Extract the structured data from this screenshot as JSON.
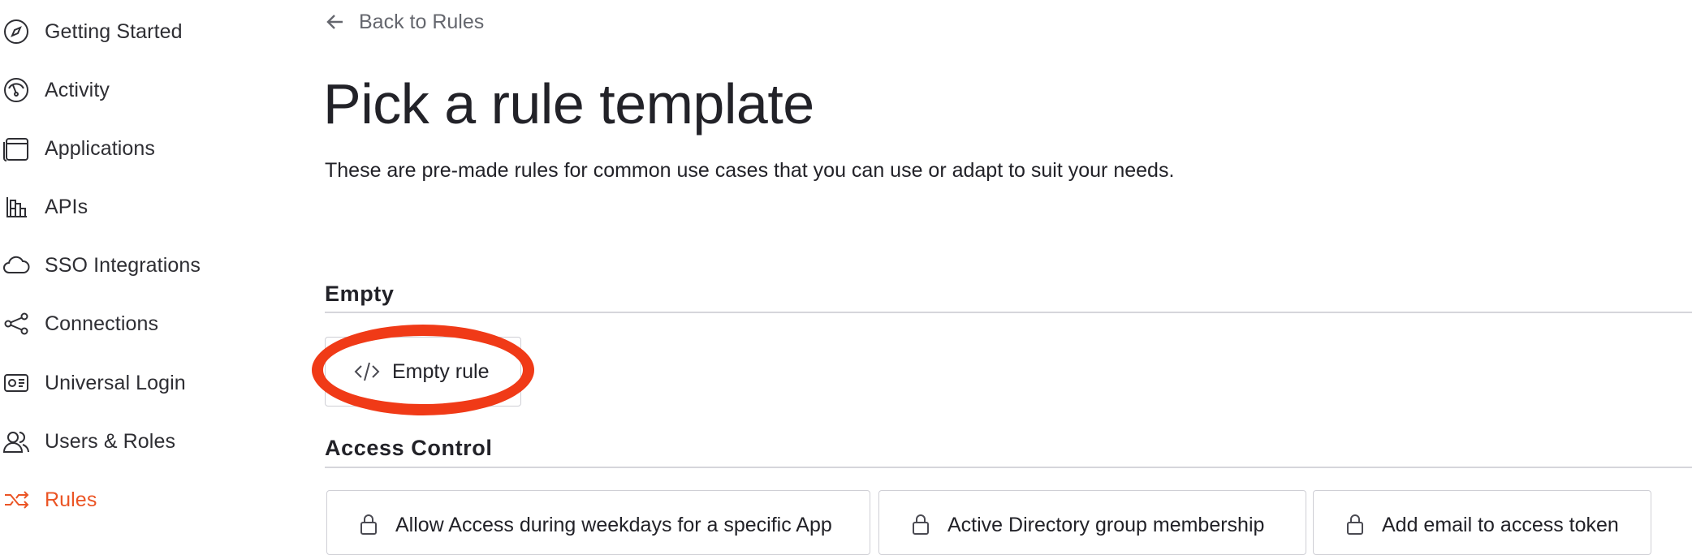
{
  "sidebar": {
    "items": [
      {
        "label": "Getting Started",
        "icon": "compass-icon"
      },
      {
        "label": "Activity",
        "icon": "gauge-icon"
      },
      {
        "label": "Applications",
        "icon": "window-icon"
      },
      {
        "label": "APIs",
        "icon": "api-blocks-icon"
      },
      {
        "label": "SSO Integrations",
        "icon": "cloud-icon"
      },
      {
        "label": "Connections",
        "icon": "share-nodes-icon"
      },
      {
        "label": "Universal Login",
        "icon": "id-card-icon"
      },
      {
        "label": "Users & Roles",
        "icon": "users-icon"
      },
      {
        "label": "Rules",
        "icon": "shuffle-icon",
        "active": true
      }
    ]
  },
  "header": {
    "back_label": "Back to Rules",
    "title": "Pick a rule template",
    "description": "These are pre-made rules for common use cases that you can use or adapt to suit your needs."
  },
  "sections": {
    "empty": {
      "heading": "Empty",
      "card_label": "Empty rule"
    },
    "access_control": {
      "heading": "Access Control",
      "cards": [
        {
          "label": "Allow Access during weekdays for a specific App"
        },
        {
          "label": "Active Directory group membership"
        },
        {
          "label": "Add email to access token"
        }
      ]
    }
  },
  "colors": {
    "accent": "#eb5424",
    "annotation": "#f03a17",
    "text": "#222228",
    "divider": "#d6d6db"
  }
}
